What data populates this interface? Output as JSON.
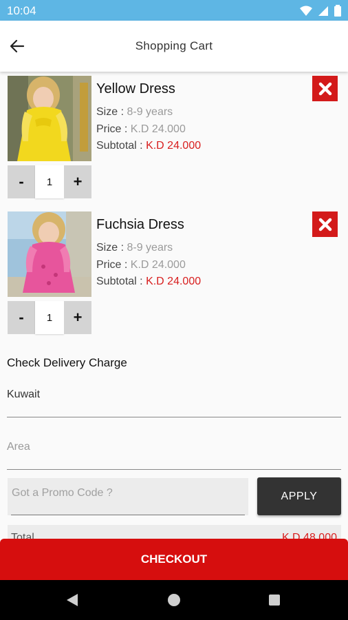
{
  "status_bar": {
    "time": "10:04"
  },
  "app_bar": {
    "title": "Shopping Cart"
  },
  "cart": {
    "items": [
      {
        "name": "Yellow Dress",
        "size_label": "Size :",
        "size_value": "8-9 years",
        "price_label": "Price :",
        "price_value": "K.D 24.000",
        "subtotal_label": "Subtotal :",
        "subtotal_value": "K.D 24.000",
        "qty": "1",
        "minus": "-",
        "plus": "+"
      },
      {
        "name": "Fuchsia Dress",
        "size_label": "Size :",
        "size_value": "8-9 years",
        "price_label": "Price :",
        "price_value": "K.D 24.000",
        "subtotal_label": "Subtotal :",
        "subtotal_value": "K.D 24.000",
        "qty": "1",
        "minus": "-",
        "plus": "+"
      }
    ]
  },
  "delivery": {
    "title": "Check Delivery Charge",
    "country_value": "Kuwait",
    "area_placeholder": "Area"
  },
  "promo": {
    "placeholder": "Got a Promo Code ?",
    "apply_label": "APPLY"
  },
  "total": {
    "label": "Total",
    "value": "K.D 48.000"
  },
  "checkout": {
    "label": "CHECKOUT"
  },
  "colors": {
    "status_bar": "#5eb6e4",
    "accent_red": "#d60e0e",
    "apply_button": "#333333"
  }
}
